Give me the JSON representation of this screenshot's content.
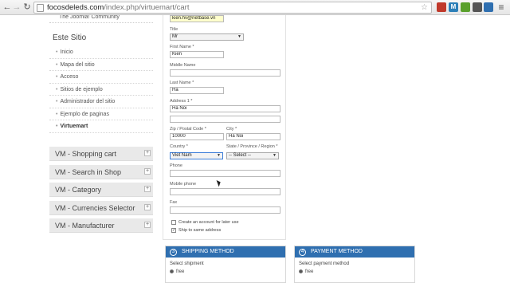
{
  "browser": {
    "url_host": "focosdeleds.com",
    "url_path": "/index.php/virtuemart/cart",
    "ext_colors": [
      "#c0392b",
      "#2c7fb8",
      "#5aa02c",
      "#555555",
      "#2f6fb0"
    ],
    "ext_labels": [
      "",
      "M",
      "",
      "",
      ""
    ]
  },
  "sidebar": {
    "community_text": "The Joomla! Community",
    "title": "Este Sitio",
    "items": [
      {
        "label": "Inicio"
      },
      {
        "label": "Mapa del sitio"
      },
      {
        "label": "Acceso"
      },
      {
        "label": "Sitios de ejemplo"
      },
      {
        "label": "Administrador del sitio"
      },
      {
        "label": "Ejemplo de paginas"
      },
      {
        "label": "Virtuemart"
      }
    ],
    "modules": [
      {
        "label": "VM - Shopping cart"
      },
      {
        "label": "VM - Search in Shop"
      },
      {
        "label": "VM - Category"
      },
      {
        "label": "VM - Currencies Selector"
      },
      {
        "label": "VM - Manufacturer"
      }
    ]
  },
  "form": {
    "email_value": "kien.hv@netbase.vn",
    "title_label": "Title",
    "title_value": "Mr",
    "first_name_label": "First Name *",
    "first_name_value": "Kien",
    "middle_name_label": "Middle Name",
    "middle_name_value": "",
    "last_name_label": "Last Name *",
    "last_name_value": "Ha",
    "address1_label": "Address 1 *",
    "address1_value": "Ha Noi",
    "address2_value": "",
    "zip_label": "Zip / Postal Code *",
    "zip_value": "10000",
    "city_label": "City *",
    "city_value": "Ha Noi",
    "country_label": "Country *",
    "country_value": "Viet Nam",
    "state_label": "State / Province / Region *",
    "state_value": "-- Select --",
    "phone_label": "Phone",
    "phone_value": "",
    "mobile_label": "Mobile phone",
    "mobile_value": "",
    "fax_label": "Fax",
    "fax_value": "",
    "create_account_label": "Create an account for later use",
    "create_account_checked": false,
    "ship_same_label": "Ship to same address",
    "ship_same_checked": true
  },
  "shipping": {
    "number": "3",
    "title": "SHIPPING METHOD",
    "subtitle": "Select shipment",
    "option": "free"
  },
  "payment": {
    "number": "4",
    "title": "PAYMENT METHOD",
    "subtitle": "Select payment method",
    "option": "free"
  }
}
